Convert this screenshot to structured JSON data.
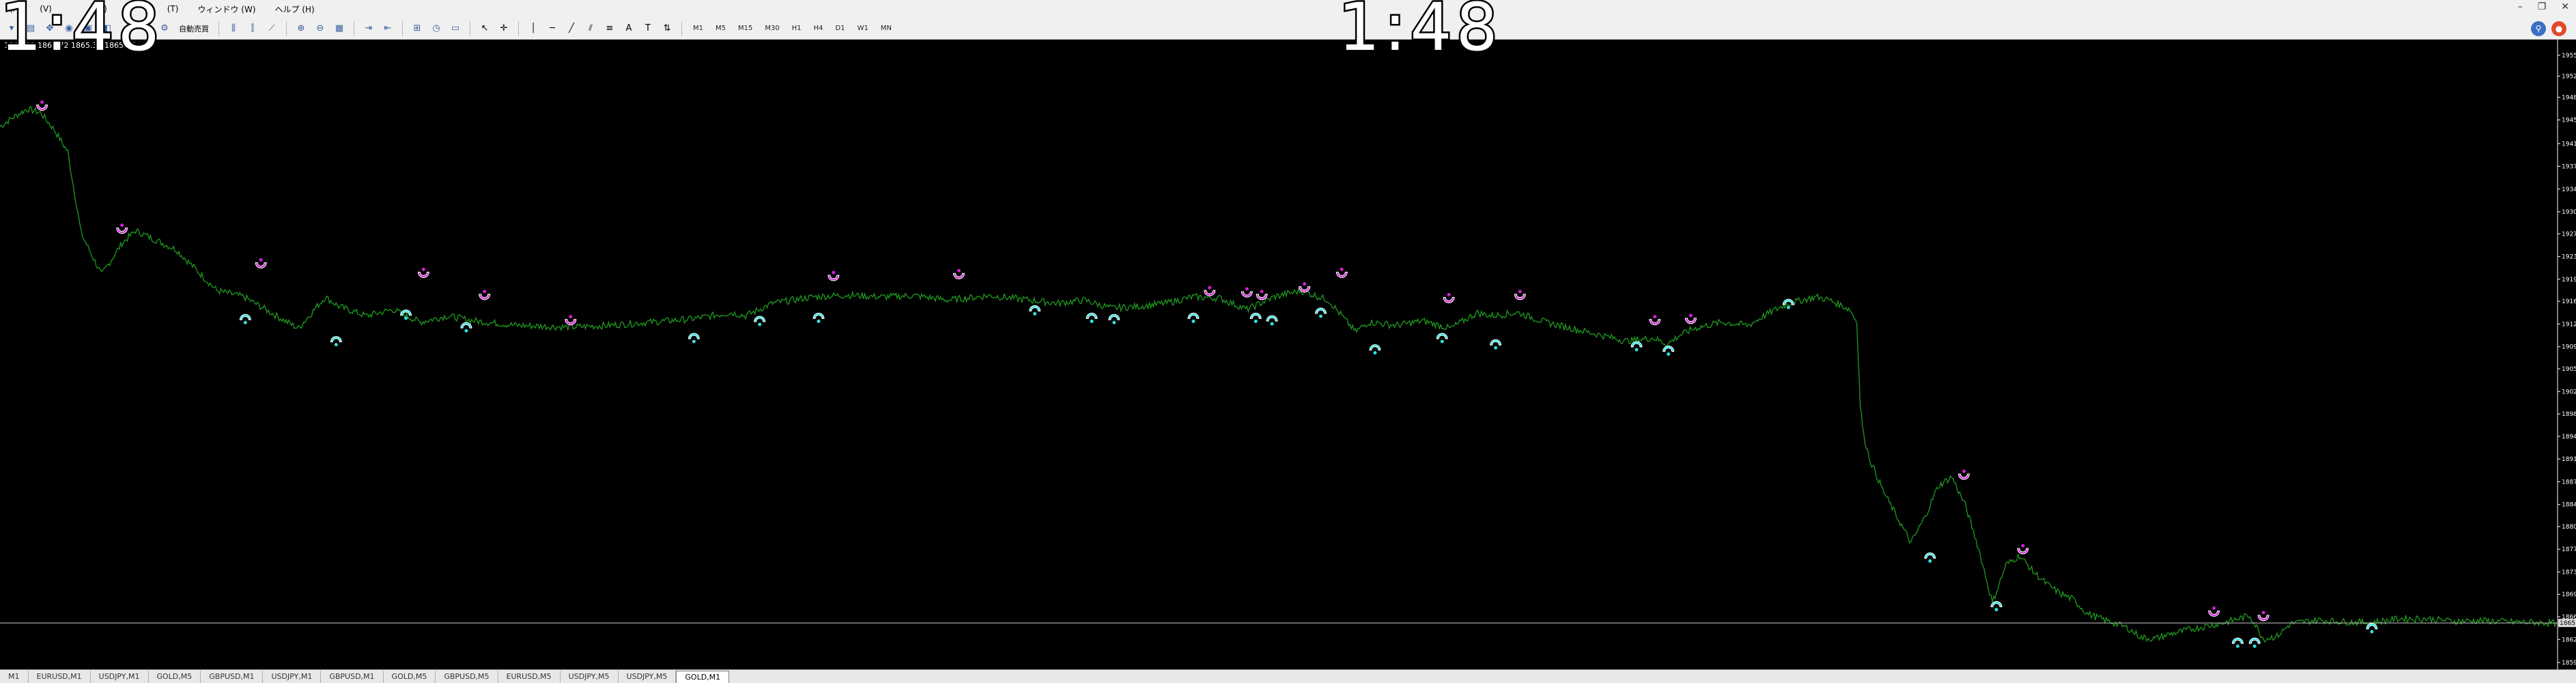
{
  "menubar": {
    "items": [
      "(F)",
      "(V)",
      "(I)",
      "(T)",
      "ウィンドウ (W)",
      "ヘルプ (H)"
    ]
  },
  "clock": {
    "left": "1:48",
    "center": "1:48"
  },
  "toolbar": {
    "auto_trade_label": "自動売買",
    "periods": [
      "M1",
      "M5",
      "M15",
      "M30",
      "H1",
      "H4",
      "D1",
      "W1",
      "MN"
    ]
  },
  "ohlc_text": "1865.32 1865.72 1865.32 1865.32",
  "chart_data": {
    "type": "line",
    "symbol": "GOLD",
    "timeframe": "M1",
    "line_color": "#1f9a1f",
    "ylim": [
      1859.05,
      1956.7
    ],
    "y_ticks": [
      "1955.30",
      "1952.00",
      "1948.65",
      "1945.05",
      "1941.30",
      "1937.70",
      "1934.10",
      "1930.50",
      "1927.00",
      "1923.40",
      "1919.80",
      "1916.30",
      "1912.70",
      "1909.10",
      "1905.60",
      "1902.00",
      "1898.45",
      "1894.90",
      "1891.30",
      "1887.70",
      "1884.10",
      "1880.60",
      "1877.00",
      "1873.40",
      "1869.85",
      "1866.30",
      "1862.70",
      "1859.05"
    ],
    "current_price": "1865.32",
    "current_price_value": 1865.32,
    "x": [
      0,
      20,
      40,
      60,
      80,
      100,
      120,
      150,
      180,
      200,
      260,
      320,
      360,
      400,
      440,
      480,
      500,
      540,
      580,
      620,
      660,
      700,
      760,
      840,
      900,
      960,
      1020,
      1080,
      1100,
      1140,
      1200,
      1250,
      1300,
      1350,
      1400,
      1460,
      1520,
      1560,
      1600,
      1640,
      1680,
      1720,
      1760,
      1800,
      1840,
      1880,
      1920,
      1960,
      2000,
      2020,
      2060,
      2100,
      2140,
      2180,
      2200,
      2240,
      2280,
      2320,
      2360,
      2400,
      2440,
      2460,
      2480,
      2500,
      2540,
      2580,
      2600,
      2620,
      2640,
      2660,
      2680,
      2700,
      2720,
      2730,
      2740,
      2745,
      2750,
      2760,
      2780,
      2800,
      2820,
      2840,
      2860,
      2880,
      2900,
      2920,
      2940,
      2960,
      2980,
      3000,
      3020,
      3040,
      3060,
      3080,
      3100,
      3120,
      3140,
      3160,
      3180,
      3200,
      3240,
      3280,
      3320,
      3340,
      3360,
      3380,
      3420,
      3460,
      3500,
      3540,
      3580,
      3620,
      3660,
      3700,
      3740,
      3772
    ],
    "values": [
      1944.0,
      1945.5,
      1946.8,
      1946.2,
      1943.5,
      1940.0,
      1927.0,
      1920.5,
      1925.5,
      1927.5,
      1924.5,
      1918.0,
      1917.0,
      1914.5,
      1912.0,
      1917.0,
      1915.5,
      1914.0,
      1915.0,
      1913.0,
      1914.0,
      1913.2,
      1912.5,
      1912.2,
      1912.5,
      1913.0,
      1913.5,
      1914.5,
      1914.0,
      1916.0,
      1917.0,
      1917.3,
      1917.0,
      1917.2,
      1916.5,
      1917.2,
      1916.5,
      1916.0,
      1916.5,
      1915.2,
      1915.5,
      1916.0,
      1917.0,
      1916.8,
      1915.0,
      1917.0,
      1918.0,
      1916.5,
      1911.5,
      1913.0,
      1912.5,
      1913.2,
      1912.0,
      1914.5,
      1914.0,
      1914.5,
      1913.0,
      1912.0,
      1911.0,
      1910.0,
      1910.5,
      1909.5,
      1911.0,
      1912.0,
      1913.0,
      1912.5,
      1913.8,
      1915.0,
      1916.0,
      1916.5,
      1917.0,
      1916.5,
      1915.5,
      1915.0,
      1913.0,
      1900.0,
      1895.0,
      1891.0,
      1886.0,
      1882.0,
      1878.0,
      1882.0,
      1887.0,
      1888.5,
      1884.0,
      1877.0,
      1868.5,
      1874.5,
      1876.0,
      1873.5,
      1871.5,
      1870.0,
      1869.0,
      1866.8,
      1866.0,
      1865.3,
      1864.5,
      1863.0,
      1862.8,
      1863.5,
      1864.5,
      1865.3,
      1866.5,
      1862.8,
      1863.2,
      1865.2,
      1865.8,
      1865.5,
      1865.4,
      1866.0,
      1866.0,
      1865.6,
      1865.7,
      1865.5,
      1865.4,
      1865.3,
      1865.32
    ],
    "sell_arrows": [
      [
        62,
        1947.0
      ],
      [
        180,
        1927.5
      ],
      [
        385,
        1922.0
      ],
      [
        625,
        1920.5
      ],
      [
        715,
        1917.0
      ],
      [
        842,
        1913.0
      ],
      [
        1230,
        1920.0
      ],
      [
        1415,
        1920.3
      ],
      [
        1785,
        1917.6
      ],
      [
        1840,
        1917.4
      ],
      [
        1862,
        1917.0
      ],
      [
        1925,
        1918.2
      ],
      [
        1980,
        1920.5
      ],
      [
        2138,
        1916.5
      ],
      [
        2243,
        1917.0
      ],
      [
        2442,
        1913.0
      ],
      [
        2495,
        1913.2
      ],
      [
        2898,
        1888.5
      ],
      [
        2985,
        1876.7
      ],
      [
        3267,
        1866.8
      ],
      [
        3340,
        1866.1
      ]
    ],
    "buy_arrows": [
      [
        362,
        1913.8
      ],
      [
        496,
        1910.3
      ],
      [
        599,
        1914.5
      ],
      [
        688,
        1912.5
      ],
      [
        1024,
        1910.8
      ],
      [
        1121,
        1913.5
      ],
      [
        1208,
        1914.0
      ],
      [
        1527,
        1915.2
      ],
      [
        1611,
        1914.0
      ],
      [
        1644,
        1913.8
      ],
      [
        1761,
        1914.0
      ],
      [
        1853,
        1914.0
      ],
      [
        1877,
        1913.6
      ],
      [
        1949,
        1914.8
      ],
      [
        2029,
        1909.0
      ],
      [
        2128,
        1910.8
      ],
      [
        2207,
        1909.8
      ],
      [
        2415,
        1909.5
      ],
      [
        2462,
        1908.8
      ],
      [
        2639,
        1916.2
      ],
      [
        2848,
        1876.0
      ],
      [
        2946,
        1868.3
      ],
      [
        3302,
        1862.5
      ],
      [
        3327,
        1862.5
      ],
      [
        3500,
        1864.8
      ]
    ]
  },
  "tabs": {
    "items": [
      "M1",
      "EURUSD,M1",
      "USDJPY,M1",
      "GOLD,M5",
      "GBPUSD,M1",
      "USDJPY,M1",
      "GBPUSD,M1",
      "GOLD,M5",
      "GBPUSD,M5",
      "EURUSD,M5",
      "USDJPY,M5",
      "USDJPY,M5",
      "GOLD,M1"
    ],
    "active": "GOLD,M1"
  }
}
